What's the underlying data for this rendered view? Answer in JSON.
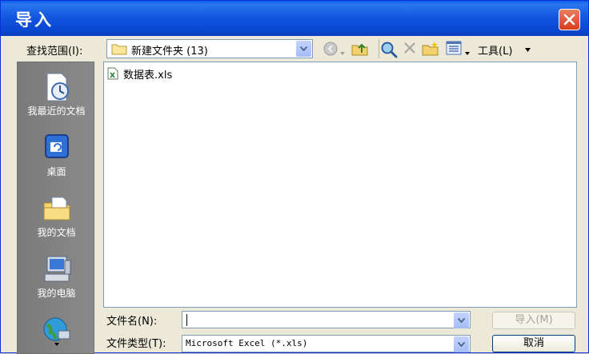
{
  "window": {
    "title": "导入"
  },
  "lookin": {
    "label": "查找范围(I):",
    "value": "新建文件夹 (13)"
  },
  "toolbar": {
    "tools_label": "工具(L)",
    "icons": [
      "back-icon",
      "up-folder-icon",
      "search-web-icon",
      "delete-icon",
      "new-folder-icon",
      "views-icon"
    ]
  },
  "places": [
    {
      "label": "我最近的文档",
      "icon": "recent-documents-icon"
    },
    {
      "label": "桌面",
      "icon": "desktop-icon"
    },
    {
      "label": "我的文档",
      "icon": "my-documents-icon"
    },
    {
      "label": "我的电脑",
      "icon": "my-computer-icon"
    },
    {
      "label": "",
      "icon": "network-places-icon"
    }
  ],
  "files": [
    {
      "name": "数据表.xls",
      "icon": "excel-file-icon"
    }
  ],
  "filename": {
    "label": "文件名(N):",
    "value": ""
  },
  "filetype": {
    "label": "文件类型(T):",
    "value": "Microsoft Excel (*.xls)"
  },
  "buttons": {
    "import": "导入(M)",
    "cancel": "取消"
  },
  "colors": {
    "titlebar": "#0b48d4",
    "close": "#d63c1c",
    "places_bg": "#808080",
    "dialog_bg": "#ece9d8"
  }
}
